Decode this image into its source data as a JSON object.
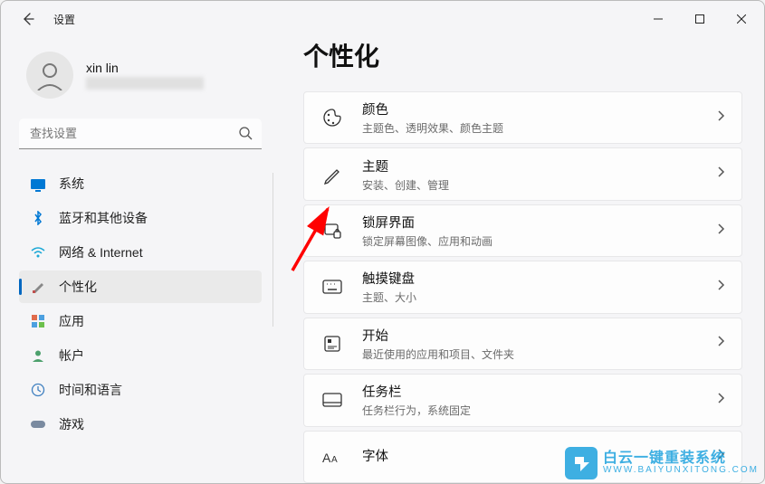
{
  "app_title": "设置",
  "page_title": "个性化",
  "user": {
    "name": "xin lin"
  },
  "search": {
    "placeholder": "查找设置"
  },
  "nav": [
    {
      "id": "system",
      "label": "系统"
    },
    {
      "id": "bluetooth",
      "label": "蓝牙和其他设备"
    },
    {
      "id": "network",
      "label": "网络 & Internet"
    },
    {
      "id": "personalization",
      "label": "个性化",
      "active": true
    },
    {
      "id": "apps",
      "label": "应用"
    },
    {
      "id": "accounts",
      "label": "帐户"
    },
    {
      "id": "time-language",
      "label": "时间和语言"
    },
    {
      "id": "gaming",
      "label": "游戏"
    }
  ],
  "cards": [
    {
      "id": "colors",
      "title": "颜色",
      "sub": "主题色、透明效果、颜色主题"
    },
    {
      "id": "themes",
      "title": "主题",
      "sub": "安装、创建、管理"
    },
    {
      "id": "lockscreen",
      "title": "锁屏界面",
      "sub": "锁定屏幕图像、应用和动画"
    },
    {
      "id": "touch-keyboard",
      "title": "触摸键盘",
      "sub": "主题、大小"
    },
    {
      "id": "start",
      "title": "开始",
      "sub": "最近使用的应用和项目、文件夹"
    },
    {
      "id": "taskbar",
      "title": "任务栏",
      "sub": "任务栏行为，系统固定"
    },
    {
      "id": "fonts",
      "title": "字体",
      "sub": ""
    }
  ],
  "watermark": {
    "main": "白云一键重装系统",
    "sub": "WWW.BAIYUNXITONG.COM"
  }
}
